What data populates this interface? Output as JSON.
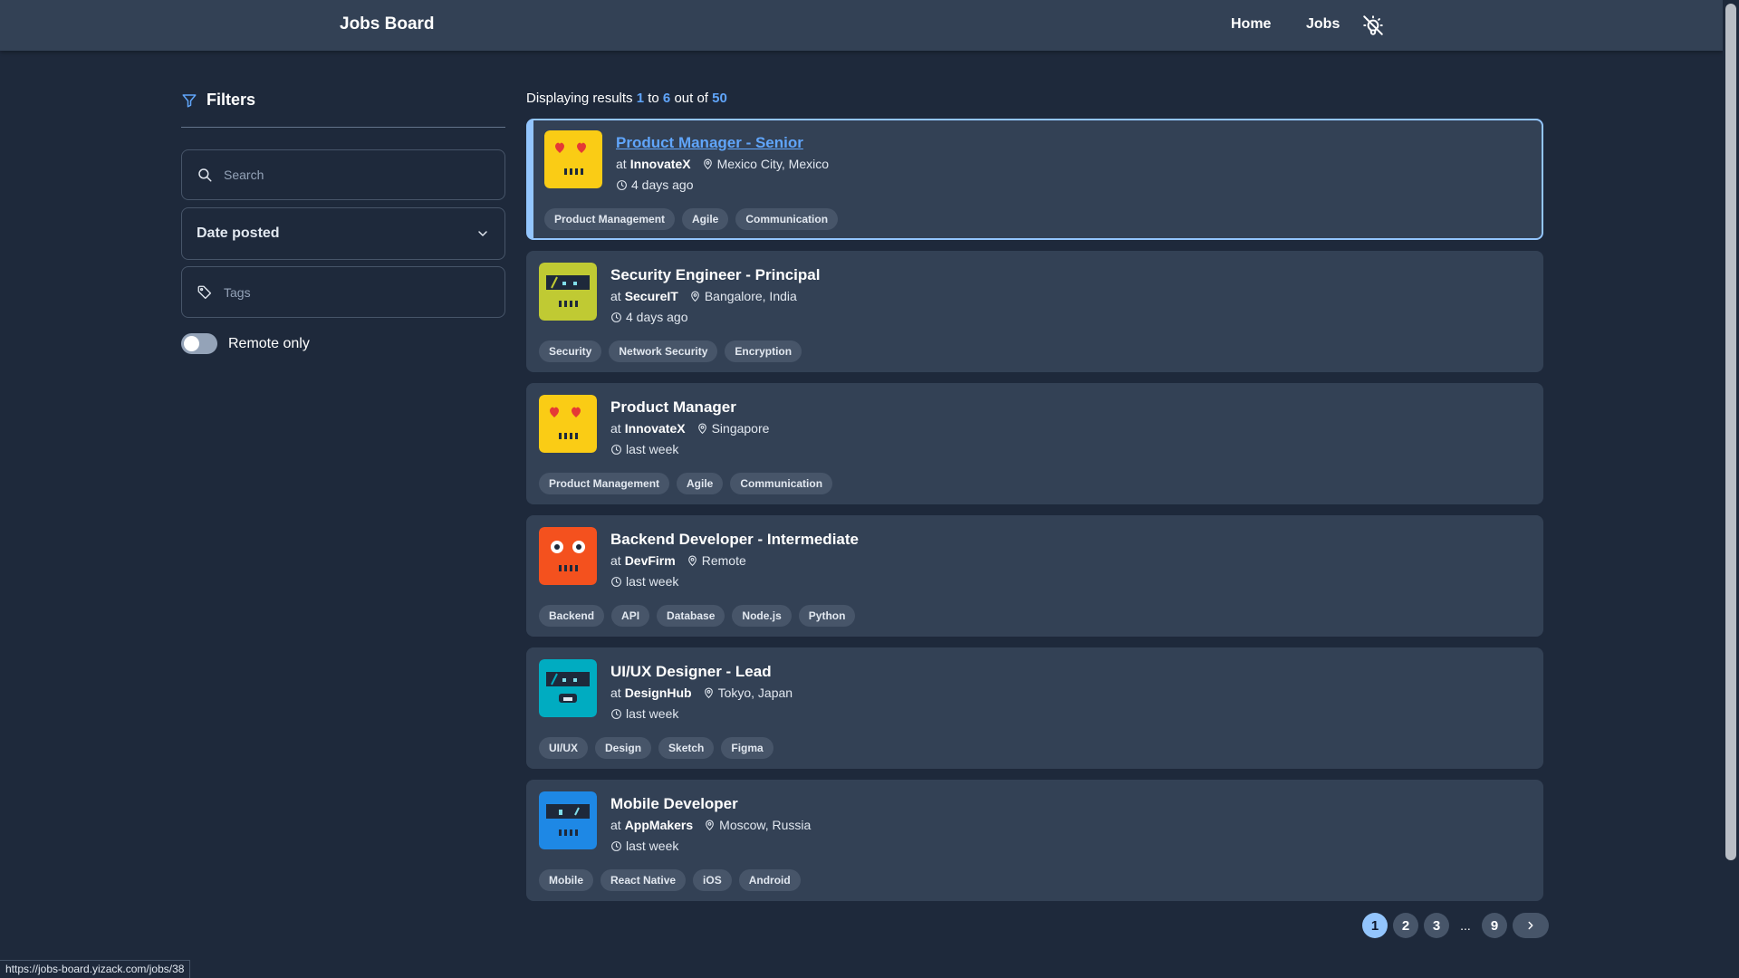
{
  "header": {
    "brand": "Jobs Board",
    "nav": {
      "home": "Home",
      "jobs": "Jobs"
    },
    "theme_icon": "light-bulb-off-icon"
  },
  "filters": {
    "title": "Filters",
    "search_placeholder": "Search",
    "date_posted_label": "Date posted",
    "tags_placeholder": "Tags",
    "remote_only_label": "Remote only",
    "remote_only_on": false
  },
  "results": {
    "prefix": "Displaying results",
    "from": "1",
    "to_word": "to",
    "to": "6",
    "out_of_word": "out of",
    "total": "50"
  },
  "jobs": [
    {
      "title": "Product Manager - Senior",
      "at": "at",
      "company": "InnovateX",
      "location": "Mexico City, Mexico",
      "posted": "4 days ago",
      "tags": [
        "Product Management",
        "Agile",
        "Communication"
      ],
      "logo_color": "#facc15",
      "active": true
    },
    {
      "title": "Security Engineer - Principal",
      "at": "at",
      "company": "SecureIT",
      "location": "Bangalore, India",
      "posted": "4 days ago",
      "tags": [
        "Security",
        "Network Security",
        "Encryption"
      ],
      "logo_color": "#c0ca33",
      "active": false
    },
    {
      "title": "Product Manager",
      "at": "at",
      "company": "InnovateX",
      "location": "Singapore",
      "posted": "last week",
      "tags": [
        "Product Management",
        "Agile",
        "Communication"
      ],
      "logo_color": "#facc15",
      "active": false
    },
    {
      "title": "Backend Developer - Intermediate",
      "at": "at",
      "company": "DevFirm",
      "location": "Remote",
      "posted": "last week",
      "tags": [
        "Backend",
        "API",
        "Database",
        "Node.js",
        "Python"
      ],
      "logo_color": "#f4511e",
      "active": false
    },
    {
      "title": "UI/UX Designer - Lead",
      "at": "at",
      "company": "DesignHub",
      "location": "Tokyo, Japan",
      "posted": "last week",
      "tags": [
        "UI/UX",
        "Design",
        "Sketch",
        "Figma"
      ],
      "logo_color": "#00acc1",
      "active": false
    },
    {
      "title": "Mobile Developer",
      "at": "at",
      "company": "AppMakers",
      "location": "Moscow, Russia",
      "posted": "last week",
      "tags": [
        "Mobile",
        "React Native",
        "iOS",
        "Android"
      ],
      "logo_color": "#1e88e5",
      "active": false
    }
  ],
  "pagination": {
    "pages": [
      "1",
      "2",
      "3"
    ],
    "ellipsis": "...",
    "last": "9",
    "current": "1"
  },
  "status_url": "https://jobs-board.yizack.com/jobs/38"
}
